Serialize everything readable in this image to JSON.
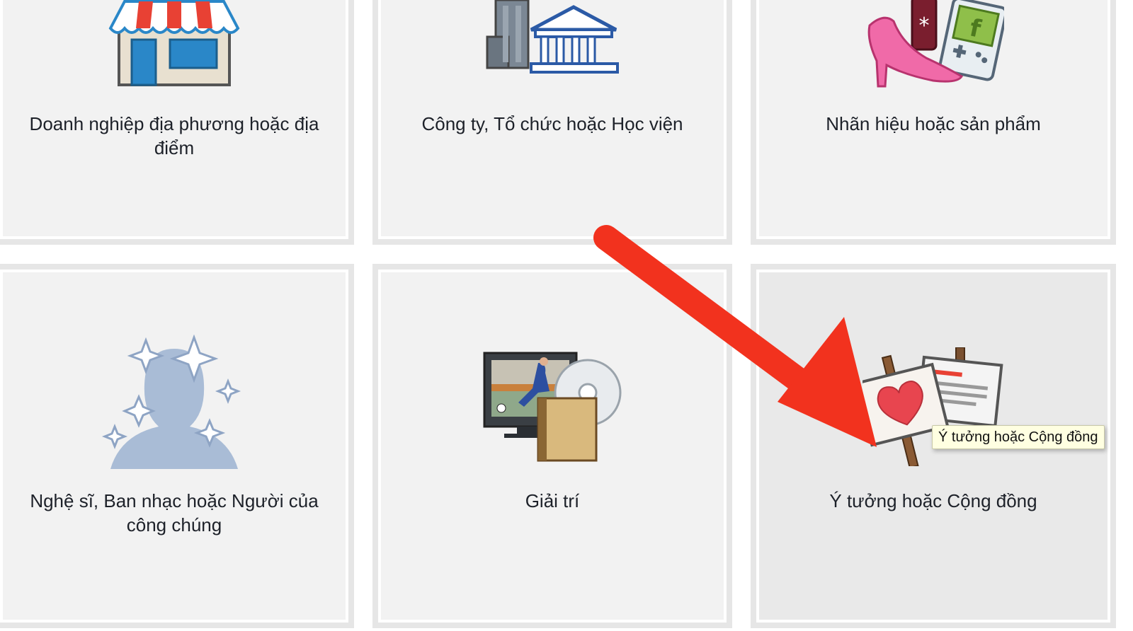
{
  "categories": [
    {
      "label": "Doanh nghiệp địa phương hoặc địa điểm",
      "icon": "storefront-icon"
    },
    {
      "label": "Công ty, Tổ chức hoặc Học viện",
      "icon": "bank-building-icon"
    },
    {
      "label": "Nhãn hiệu hoặc sản phẩm",
      "icon": "products-icon"
    },
    {
      "label": "Nghệ sĩ, Ban nhạc hoặc Người của công chúng",
      "icon": "celebrity-silhouette-icon"
    },
    {
      "label": "Giải trí",
      "icon": "entertainment-tv-icon"
    },
    {
      "label": "Ý tưởng hoặc Cộng đồng",
      "icon": "protest-signs-icon"
    }
  ],
  "hovered_index": 5,
  "tooltip": {
    "text": "Ý tưởng hoặc Cộng đồng"
  },
  "colors": {
    "tile_bg": "#f2f2f2",
    "tile_border": "#e6e6e6",
    "tile_hover_bg": "#e9e9e9",
    "arrow": "#f2321e",
    "tooltip_bg": "#ffffe1"
  }
}
